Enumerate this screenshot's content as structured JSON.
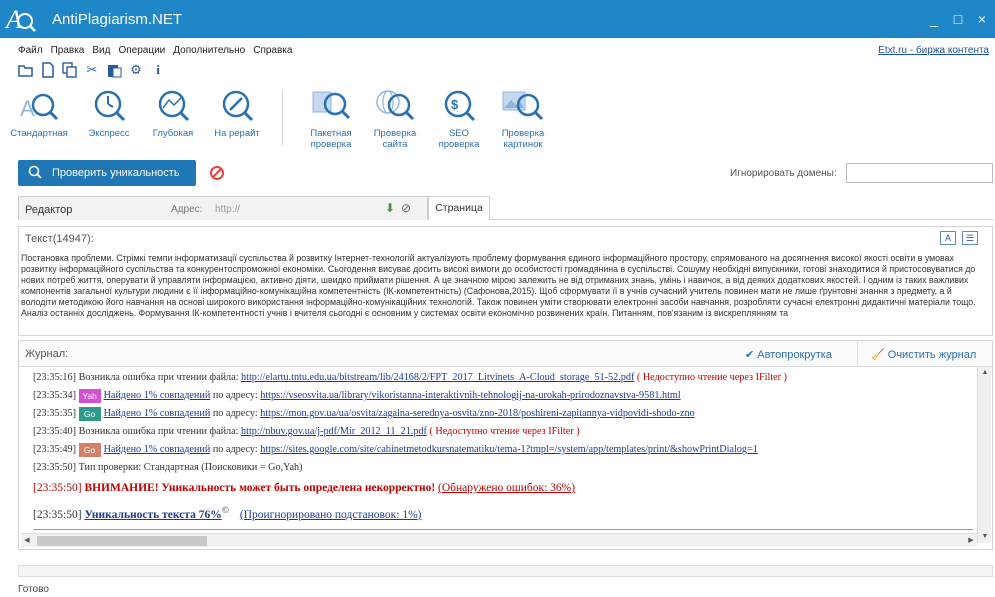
{
  "app": {
    "title": "AntiPlagiarism.NET",
    "logo_text": "A"
  },
  "window": {
    "minimize": "_",
    "maximize": "□",
    "close": "×"
  },
  "menu": {
    "items": [
      "Файл",
      "Правка",
      "Вид",
      "Операции",
      "Дополнительно",
      "Справка"
    ],
    "etxt_link": "Etxt.ru - биржа контента"
  },
  "quick_toolbar": [
    "open-folder-icon",
    "new-file-icon",
    "copy-icon",
    "cut-icon",
    "paste-icon",
    "settings-icon",
    "info-icon"
  ],
  "ribbon": {
    "check_modes": [
      {
        "label": "Стандартная",
        "icon": "standard-check-icon"
      },
      {
        "label": "Экспресс",
        "icon": "express-check-icon"
      },
      {
        "label": "Глубокая",
        "icon": "deep-check-icon"
      },
      {
        "label": "На рерайт",
        "icon": "rewrite-check-icon"
      }
    ],
    "tools": [
      {
        "label": "Пакетная\nпроверка",
        "icon": "batch-check-icon"
      },
      {
        "label": "Проверка\nсайта",
        "icon": "site-check-icon"
      },
      {
        "label": "SEO\nпроверка",
        "icon": "seo-check-icon"
      },
      {
        "label": "Проверка\nкартинок",
        "icon": "image-check-icon"
      }
    ]
  },
  "actions": {
    "check_button": "Проверить уникальность",
    "ignore_domains_label": "Игнорировать домены:",
    "ignore_domains_value": ""
  },
  "editor": {
    "tab_label": "Редактор",
    "address_label": "Адрес:",
    "address_placeholder": "http://",
    "page_tab": "Страница"
  },
  "text_panel": {
    "header": "Текст(14947):",
    "content": "Постановка проблеми. Стрімкі темпи інформатизації суспільства й розвитку Інтернет-технологій актуалізують проблему формування єдиного інформаційного простору, спрямованого на досягнення високої якості освіти в умовах розвитку інформаційного суспільства та конкурентоспроможної економіки. Сьогодення висуває досить високі вимоги до особистості громадянина в суспільстві. Сошуму необхідні випускники, готові знаходитися й пристосовуватися до нових потреб життя, оперувати й управляти інформацією, активно діяти, швидко приймати рішення. А це значною мірою залежить не від отриманих знань, умінь і навичок, а від деяких додаткових якостей. І одним із таких важливих компонентів загальної культури людини є її інформаційно-комунікаційна компетентність (ІК-компетентність) (Сафонова,2015). Щоб сформувати її в учнів сучасний учитель повинен мати не лише ґрунтовні знання з предмету, а й володіти методикою його навчання на основі широкого використання інформаційно-комунікаційних технологій. Також повинен уміти створювати електронні засоби навчання, розробляти сучасні електронні дидактичні матеріали тощо. Аналіз останніх досліджень. Формування ІК-компетентності учнів і вчителя сьогодні є основним у системах освіти економічно розвинених країн. Питанням, пов'язаним із вискреплянням та"
  },
  "journal": {
    "label": "Журнал:",
    "autoscroll": "Автопрокрутка",
    "clear": "Очистить журнал",
    "entries": [
      {
        "time": "[23:35:16]",
        "pre": "Возникла ошибка при чтении файла: ",
        "link": "http://elartu.tntu.edu.ua/bitstream/lib/24168/2/FPT_2017_Litvinets_A-Cloud_storage_51-52.pdf",
        "post": " ( Недоступно чтение через IFilter )",
        "badge": "",
        "badge_color": ""
      },
      {
        "time": "[23:35:34]",
        "badge": "Yah",
        "badge_color": "#d24fd0",
        "pre": "Найдено 1% совпадений",
        "mid": " по адресу: ",
        "link": "https://vseosvita.ua/library/vikoristanna-interaktivnih-tehnologij-na-urokah-prirodoznavstva-9581.html"
      },
      {
        "time": "[23:35:35]",
        "badge": "Go",
        "badge_color": "#2e9a8a",
        "pre": "Найдено 1% совпадений",
        "mid": " по адресу: ",
        "link": "https://mon.gov.ua/ua/osvita/zagalna-serednya-osvita/zno-2018/poshireni-zapitannya-vidpovidi-shodo-zno"
      },
      {
        "time": "[23:35:40]",
        "pre": "Возникла ошибка при чтении файла: ",
        "link": "http://nbuv.gov.ua/j-pdf/Mir_2012_11_21.pdf",
        "post": " ( Недоступно чтение через IFilter )",
        "badge": "",
        "badge_color": ""
      },
      {
        "time": "[23:35:49]",
        "badge": "Go",
        "badge_color": "#d2806a",
        "pre": "Найдено 1% совпадений",
        "mid": " по адресу: ",
        "link": "https://sites.google.com/site/cabinetmetodkursnatematiku/tema-1?tmpl=/system/app/templates/print/&showPrintDialog=1"
      },
      {
        "time": "[23:35:50]",
        "check_type_text": "Тип проверки: Стандартная (Поисковики = Go,Yah)"
      }
    ],
    "warning_time": "[23:35:50]",
    "warning_text": "ВНИМАНИЕ! Уникальность может быть определена некорректно!",
    "warning_detail": "(Обнаружено ошибок: 36%)",
    "result_time": "[23:35:50]",
    "result_text": "Уникальность текста 76%",
    "result_sup": "©",
    "result_ignored": "(Проигнорировано подстановок: 1%)"
  },
  "status": {
    "text": "Готово"
  },
  "colors": {
    "accent": "#1f86c8",
    "check_button": "#1f78b5",
    "link": "#1a3a9a",
    "warning": "#c00000"
  }
}
